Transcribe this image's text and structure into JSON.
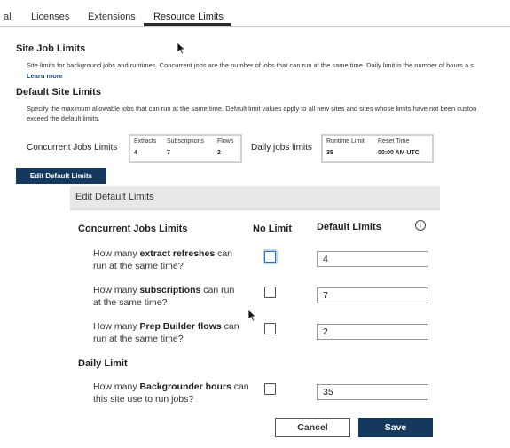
{
  "tabs": [
    {
      "label": "al"
    },
    {
      "label": "Licenses"
    },
    {
      "label": "Extensions"
    },
    {
      "label": "Resource Limits",
      "active": true
    }
  ],
  "site_job_limits": {
    "title": "Site Job Limits",
    "description": "Site limits for background jobs and runtimes. Concurrent jobs are the number of jobs that can run at the same time. Daily limit is the number of hours a s",
    "learn_more": "Learn more"
  },
  "default_site_limits": {
    "title": "Default Site Limits",
    "description_line1": "Specify the maximum allowable jobs that can run at the same time. Default limit values apply to all new sites and sites whose limits have not been custon",
    "description_line2": "exceed the default limits.",
    "concurrent_label": "Concurrent Jobs Limits",
    "concurrent": {
      "headers": [
        "Extracts",
        "Subscriptions",
        "Flows"
      ],
      "values": [
        "4",
        "7",
        "2"
      ]
    },
    "daily_label": "Daily jobs limits",
    "daily": {
      "headers": [
        "Runtime Limit",
        "Reset Time"
      ],
      "values": [
        "35",
        "00:00 AM UTC"
      ]
    },
    "edit_button": "Edit Default Limits"
  },
  "dialog": {
    "title": "Edit Default Limits",
    "concurrent_heading": "Concurrent Jobs Limits",
    "no_limit_heading": "No Limit",
    "default_limits_heading": "Default Limits",
    "daily_heading": "Daily Limit",
    "rows": [
      {
        "pre": "How many ",
        "bold": "extract refreshes",
        "post": " can run at the same time?",
        "value": "4"
      },
      {
        "pre": "How many ",
        "bold": "subscriptions",
        "post": " can run at the same time?",
        "value": "7"
      },
      {
        "pre": "How many ",
        "bold": "Prep Builder flows",
        "post": " can run at the same time?",
        "value": "2"
      },
      {
        "pre": "How many ",
        "bold": "Backgrounder hours",
        "post": " can this site use to run jobs?",
        "value": "35"
      }
    ],
    "cancel": "Cancel",
    "save": "Save"
  },
  "colors": {
    "primary": "#15395e",
    "link": "#1a4f86",
    "dialog_header": "#e8e8e8"
  }
}
